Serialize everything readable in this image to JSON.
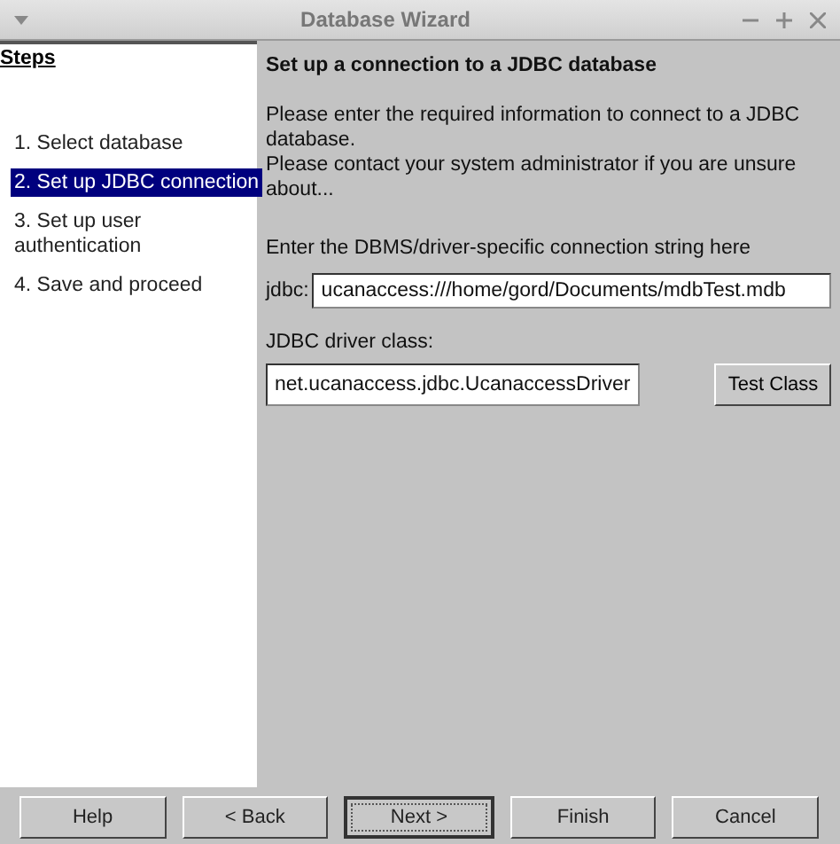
{
  "window": {
    "title": "Database Wizard"
  },
  "steps": {
    "title": "Steps",
    "items": [
      {
        "label": "1. Select database",
        "selected": false
      },
      {
        "label": "2. Set up JDBC connection",
        "selected": true
      },
      {
        "label": "3. Set up user authentication",
        "selected": false
      },
      {
        "label": "4. Save and proceed",
        "selected": false
      }
    ]
  },
  "page": {
    "heading": "Set up a connection to a JDBC database",
    "intro": [
      "Please enter the required information to connect to a JDBC database.",
      "Please contact your system administrator if you are unsure about..."
    ],
    "connection_label": "Enter the DBMS/driver-specific connection string here",
    "prefix": "jdbc:",
    "connection_value": "ucanaccess:///home/gord/Documents/mdbTest.mdb",
    "driver_label": "JDBC driver class:",
    "driver_value": "net.ucanaccess.jdbc.UcanaccessDriver",
    "test_button": "Test Class"
  },
  "buttons": [
    {
      "label": "Help",
      "focused": false
    },
    {
      "label": "< Back",
      "focused": false
    },
    {
      "label": "Next >",
      "focused": true
    },
    {
      "label": "Finish",
      "focused": false
    },
    {
      "label": "Cancel",
      "focused": false
    }
  ]
}
